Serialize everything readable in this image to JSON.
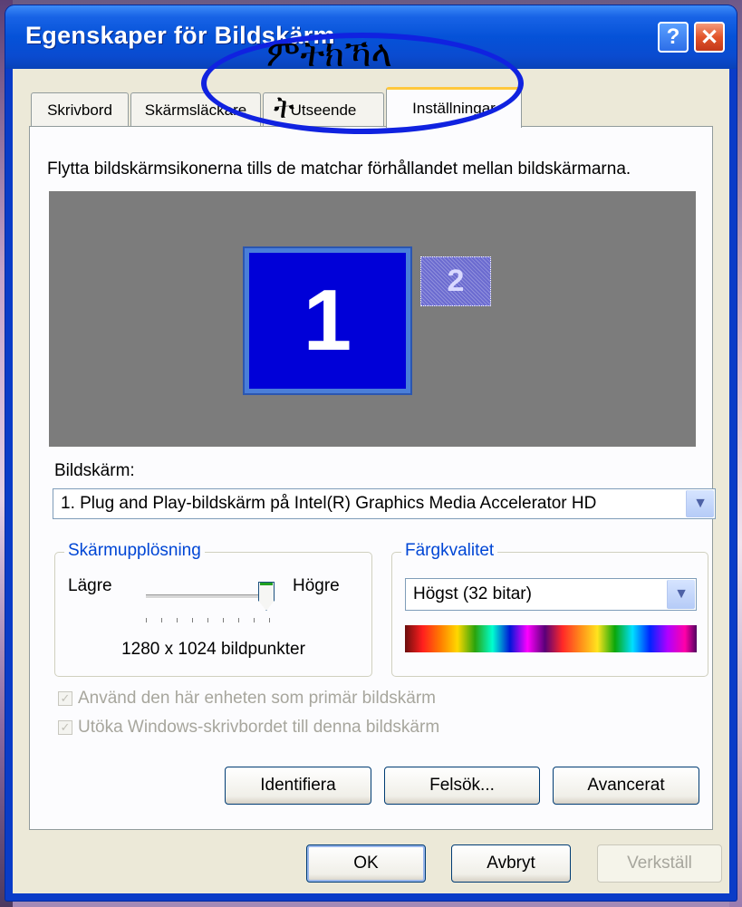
{
  "window": {
    "title": "Egenskaper för Bildskärm",
    "help_label": "?",
    "close_label": "✕"
  },
  "tabs": [
    {
      "label": "Skrivbord"
    },
    {
      "label": "Skärmsläckare"
    },
    {
      "label": "Utseende"
    },
    {
      "label": "Inställningar",
      "active": true
    }
  ],
  "annotation": {
    "line1": "ምትክኻላ",
    "line2": "ት",
    "color": "#1022e0"
  },
  "settings": {
    "instruction": "Flytta bildskärmsikonerna tills de matchar förhållandet mellan bildskärmarna.",
    "monitors": [
      {
        "label": "1"
      },
      {
        "label": "2"
      }
    ],
    "display_label": "Bildskärm:",
    "display_value": "1. Plug and Play-bildskärm på Intel(R) Graphics Media Accelerator HD",
    "resolution": {
      "group_title": "Skärmupplösning",
      "low_label": "Lägre",
      "high_label": "Högre",
      "value": "1280 x 1024 bildpunkter",
      "slider_position": 0.92
    },
    "color_quality": {
      "group_title": "Färgkvalitet",
      "value": "Högst (32 bitar)"
    },
    "checkboxes": [
      {
        "label": "Använd den här enheten som primär bildskärm",
        "checked": true,
        "disabled": true
      },
      {
        "label": "Utöka Windows-skrivbordet till denna bildskärm",
        "checked": true,
        "disabled": true
      }
    ],
    "buttons": {
      "identify": "Identifiera",
      "troubleshoot": "Felsök...",
      "advanced": "Avancerat"
    }
  },
  "dialog_buttons": {
    "ok": "OK",
    "cancel": "Avbryt",
    "apply": "Verkställ"
  },
  "colors": {
    "titlebar": "#0552d8",
    "client_bg": "#ece9d8",
    "monitor_primary": "#0000d8",
    "group_title": "#0046d5"
  }
}
